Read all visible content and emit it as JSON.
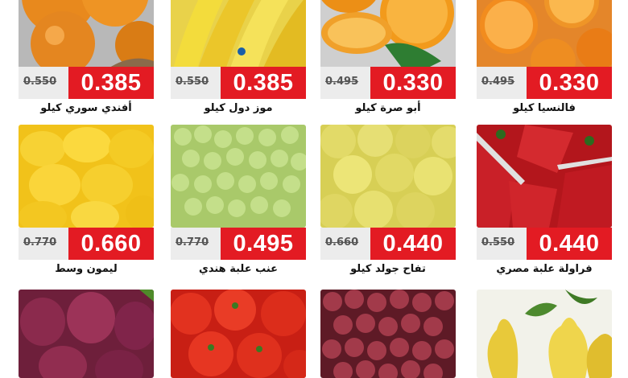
{
  "products": [
    {
      "name": "أفندي سوري كيلو",
      "old_price": "0.550",
      "price": "0.385",
      "icon": "tangerine-icon"
    },
    {
      "name": "موز دول كيلو",
      "old_price": "0.550",
      "price": "0.385",
      "icon": "banana-icon"
    },
    {
      "name": "أبو صرة كيلو",
      "old_price": "0.495",
      "price": "0.330",
      "icon": "navel-orange-icon"
    },
    {
      "name": "فالنسيا كيلو",
      "old_price": "0.495",
      "price": "0.330",
      "icon": "valencia-orange-icon"
    },
    {
      "name": "ليمون وسط",
      "old_price": "0.770",
      "price": "0.660",
      "icon": "lemon-icon"
    },
    {
      "name": "عنب علبة هندي",
      "old_price": "0.770",
      "price": "0.495",
      "icon": "grapes-icon"
    },
    {
      "name": "تفاح جولد كيلو",
      "old_price": "0.660",
      "price": "0.440",
      "icon": "golden-apple-icon"
    },
    {
      "name": "فراولة علبة مصري",
      "old_price": "0.550",
      "price": "0.440",
      "icon": "strawberry-icon"
    },
    {
      "icon": "red-onion-icon"
    },
    {
      "icon": "tomato-icon"
    },
    {
      "icon": "red-grapes-icon"
    },
    {
      "icon": "pear-icon"
    }
  ],
  "colors": {
    "price_red": "#e31b23",
    "bar_gray": "#ececec"
  }
}
